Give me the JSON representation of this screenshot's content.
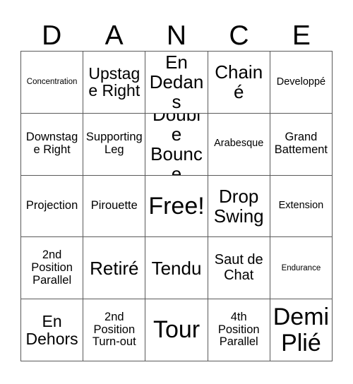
{
  "card": {
    "title_letters": [
      "D",
      "A",
      "N",
      "C",
      "E"
    ],
    "free_space_label": "Free!",
    "colors": {
      "background": "#ffffff",
      "grid_line": "#5a5a5a",
      "text": "#000000"
    },
    "rows": [
      [
        {
          "label": "Concentration",
          "size": "fs-xs"
        },
        {
          "label": "Upstage Right",
          "size": "fs-xl"
        },
        {
          "label": "En Dedans",
          "size": "fs-xxl"
        },
        {
          "label": "Chainé",
          "size": "fs-xxl"
        },
        {
          "label": "Developpé",
          "size": "fs-sm"
        }
      ],
      [
        {
          "label": "Downstage Right",
          "size": "fs-md"
        },
        {
          "label": "Supporting Leg",
          "size": "fs-md"
        },
        {
          "label": "Double Bounce",
          "size": "fs-xxl"
        },
        {
          "label": "Arabesque",
          "size": "fs-sm"
        },
        {
          "label": "Grand Battement",
          "size": "fs-md"
        }
      ],
      [
        {
          "label": "Projection",
          "size": "fs-md"
        },
        {
          "label": "Pirouette",
          "size": "fs-md"
        },
        {
          "label": "Free!",
          "size": "fs-free"
        },
        {
          "label": "Drop Swing",
          "size": "fs-xxl"
        },
        {
          "label": "Extension",
          "size": "fs-sm"
        }
      ],
      [
        {
          "label": "2nd Position Parallel",
          "size": "fs-md"
        },
        {
          "label": "Retiré",
          "size": "fs-xxl"
        },
        {
          "label": "Tendu",
          "size": "fs-xxl"
        },
        {
          "label": "Saut de Chat",
          "size": "fs-lg"
        },
        {
          "label": "Endurance",
          "size": "fs-xs"
        }
      ],
      [
        {
          "label": "En Dehors",
          "size": "fs-xl"
        },
        {
          "label": "2nd Position Turn-out",
          "size": "fs-md"
        },
        {
          "label": "Tour",
          "size": "fs-free"
        },
        {
          "label": "4th Position Parallel",
          "size": "fs-md"
        },
        {
          "label": "Demi Plié",
          "size": "fs-free"
        }
      ]
    ]
  }
}
